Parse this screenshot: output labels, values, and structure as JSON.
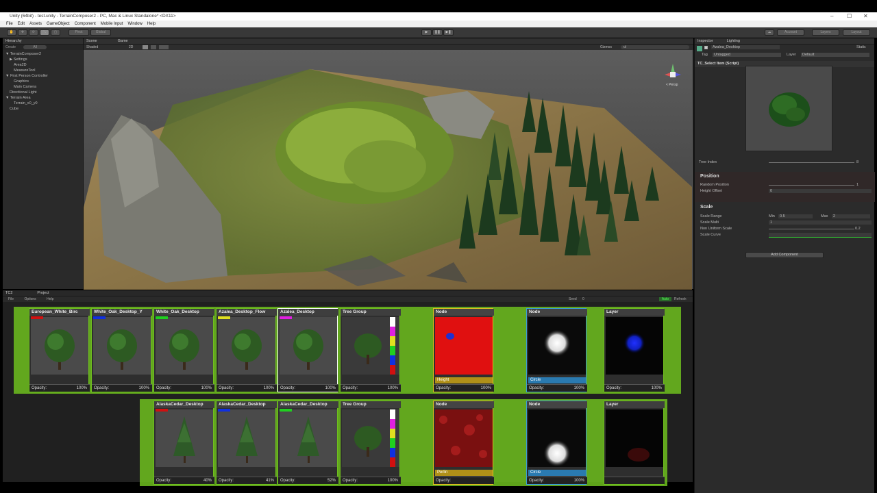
{
  "window": {
    "title": "Unity (64bit) - test.unity - TerrainComposer2 - PC, Mac & Linux Standalone* <DX11>",
    "minimize": "–",
    "maximize": "☐",
    "close": "✕"
  },
  "menu": [
    "File",
    "Edit",
    "Assets",
    "GameObject",
    "Component",
    "Mobile Input",
    "Window",
    "Help"
  ],
  "toolbar": {
    "pivot": "Pivot",
    "global": "Global",
    "account": "Account",
    "layers": "Layers",
    "layout": "Layout",
    "play": "▶",
    "pause": "❚❚",
    "step": "▶❚"
  },
  "hierarchy": {
    "tab": "Hierarchy",
    "create": "Create",
    "search": "All",
    "items": [
      {
        "label": "▼ TerrainComposer2",
        "indent": 0
      },
      {
        "label": "▶ Settings",
        "indent": 1
      },
      {
        "label": "Area2D",
        "indent": 2
      },
      {
        "label": "MeasureTool",
        "indent": 2
      },
      {
        "label": "▼ First Person Controller",
        "indent": 0
      },
      {
        "label": "Graphics",
        "indent": 2
      },
      {
        "label": "Main Camera",
        "indent": 2
      },
      {
        "label": "Directional Light",
        "indent": 1
      },
      {
        "label": "▼ Terrain Area",
        "indent": 0
      },
      {
        "label": "Terrain_x0_y0",
        "indent": 2
      },
      {
        "label": "Cube",
        "indent": 1
      }
    ]
  },
  "scene": {
    "tab_scene": "Scene",
    "tab_game": "Game",
    "shading": "Shaded",
    "mode2d": "2D",
    "gizmos": "Gizmos",
    "search": "All",
    "persp": "< Persp"
  },
  "inspector": {
    "tab_inspector": "Inspector",
    "tab_lighting": "Lighting",
    "object_name": "Azalea_Desktop",
    "static": "Static",
    "tag_label": "Tag",
    "tag_value": "Untagged",
    "layer_label": "Layer",
    "layer_value": "Default",
    "script": "TC_Select Item (Script)",
    "tree_index_label": "Tree Index",
    "tree_index_value": "8",
    "position_header": "Position",
    "random_position_label": "Random Position",
    "random_position_value": "1",
    "height_offset_label": "Height Offset",
    "height_offset_value": "0",
    "scale_header": "Scale",
    "scale_range_label": "Scale Range",
    "min_label": "Min",
    "min_value": "0.5",
    "max_label": "Max",
    "max_value": "2",
    "scale_multi_label": "Scale Multi",
    "scale_multi_value": "1",
    "non_uniform_label": "Non Uniform Scale",
    "non_uniform_value": "0.2",
    "scale_curve_label": "Scale Curve",
    "add_component": "Add Component"
  },
  "tc2": {
    "tab_tc2": "TC2",
    "tab_project": "Project",
    "file": "File",
    "options": "Options",
    "help": "Help",
    "seed_label": "Seed",
    "seed_value": "0",
    "auto": "Auto",
    "refresh": "Refresh",
    "row1": [
      {
        "name": "European_White_Birc",
        "opacity_label": "Opacity:",
        "opacity": "100%",
        "swatch": "#d01010",
        "kind": "tree"
      },
      {
        "name": "White_Oak_Desktop_Y",
        "opacity_label": "Opacity:",
        "opacity": "100%",
        "swatch": "#1030e0",
        "kind": "tree"
      },
      {
        "name": "White_Oak_Desktop",
        "opacity_label": "Opacity:",
        "opacity": "100%",
        "swatch": "#20d020",
        "kind": "tree"
      },
      {
        "name": "Azalea_Desktop_Flow",
        "opacity_label": "Opacity:",
        "opacity": "100%",
        "swatch": "#e0e020",
        "kind": "tree"
      },
      {
        "name": "Azalea_Desktop",
        "opacity_label": "Opacity:",
        "opacity": "100%",
        "swatch": "#e020e0",
        "kind": "tree"
      },
      {
        "name": "Tree Group",
        "opacity_label": "Opacity:",
        "opacity": "100%",
        "kind": "group"
      },
      {
        "name": "Node",
        "sub": "Height",
        "opacity_label": "Opacity:",
        "opacity": "100%",
        "kind": "height"
      },
      {
        "name": "Node",
        "sub": "Circle",
        "opacity_label": "Opacity:",
        "opacity": "100%",
        "kind": "circle"
      },
      {
        "name": "Layer",
        "opacity_label": "Opacity:",
        "opacity": "100%",
        "kind": "layer"
      }
    ],
    "row2": [
      {
        "name": "AlaskaCedar_Desktop",
        "opacity_label": "Opacity:",
        "opacity": "40%",
        "swatch": "#d01010",
        "kind": "cedar"
      },
      {
        "name": "AlaskaCedar_Desktop",
        "opacity_label": "Opacity:",
        "opacity": "41%",
        "swatch": "#1030e0",
        "kind": "cedar"
      },
      {
        "name": "AlaskaCedar_Desktop",
        "opacity_label": "Opacity:",
        "opacity": "52%",
        "swatch": "#20d020",
        "kind": "cedar"
      },
      {
        "name": "Tree Group",
        "opacity_label": "Opacity:",
        "opacity": "100%",
        "kind": "group"
      },
      {
        "name": "Node",
        "sub": "Perlin",
        "opacity_label": "Opacity:",
        "opacity": "",
        "kind": "perlin"
      },
      {
        "name": "Node",
        "sub": "Circle",
        "opacity_label": "Opacity:",
        "opacity": "100%",
        "kind": "circle"
      },
      {
        "name": "Layer",
        "opacity_label": "",
        "opacity": "",
        "kind": "layer2"
      }
    ]
  }
}
